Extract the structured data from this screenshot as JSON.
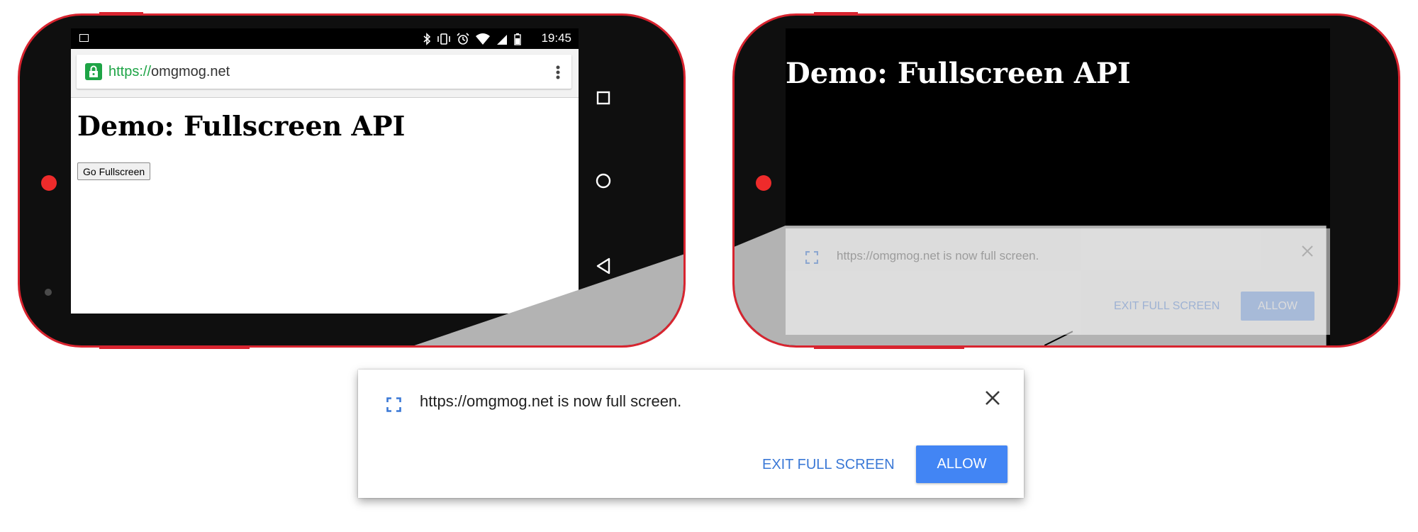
{
  "left_phone": {
    "status_bar": {
      "time": "19:45",
      "icons": [
        "image-icon",
        "bluetooth-icon",
        "vibrate-icon",
        "alarm-icon",
        "wifi-icon",
        "signal-icon",
        "battery-icon"
      ]
    },
    "url_bar": {
      "scheme": "https://",
      "host": "omgmog.net"
    },
    "page": {
      "title": "Demo: Fullscreen API",
      "button_label": "Go Fullscreen"
    },
    "nav_icons": [
      "recents-icon",
      "home-icon",
      "back-icon"
    ]
  },
  "right_phone": {
    "page": {
      "title": "Demo: Fullscreen API"
    },
    "prompt": {
      "message": "https://omgmog.net is now full screen.",
      "exit_label": "EXIT FULL SCREEN",
      "allow_label": "ALLOW"
    }
  },
  "dialog": {
    "message": "https://omgmog.net is now full screen.",
    "exit_label": "EXIT FULL SCREEN",
    "allow_label": "ALLOW"
  },
  "colors": {
    "phone_border": "#d8242f",
    "phone_body": "#0f0f0f",
    "secure_green": "#1ea446",
    "accent_blue": "#4285f4",
    "link_blue": "#3a78d6"
  }
}
